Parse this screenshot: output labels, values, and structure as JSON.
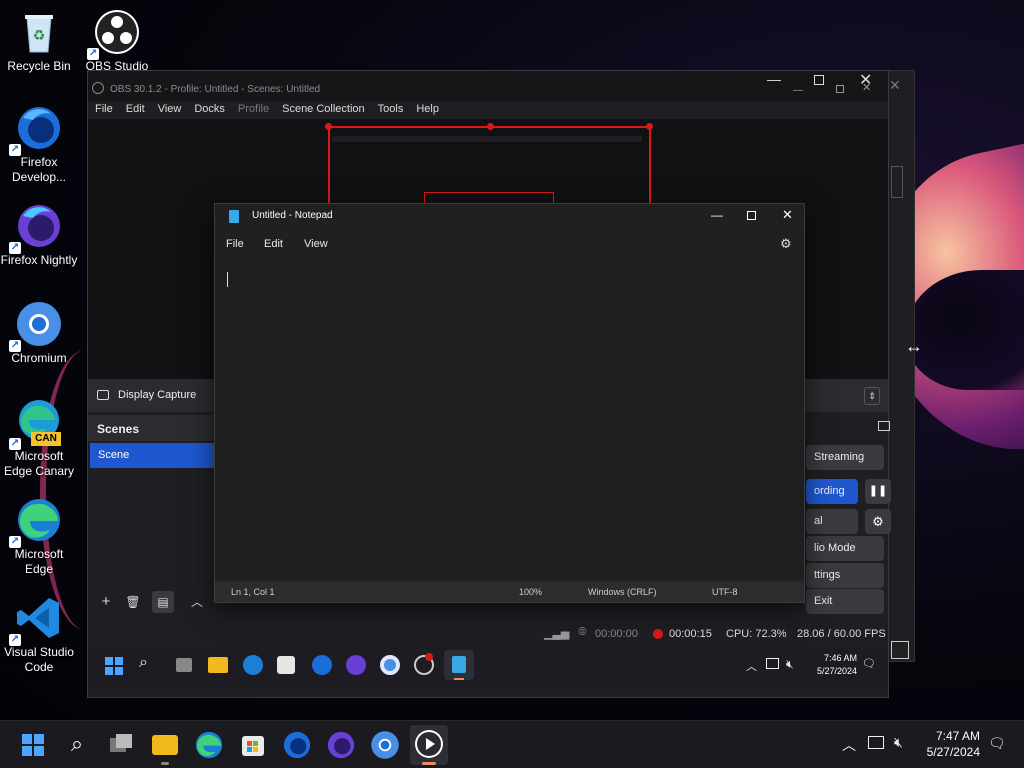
{
  "desktop": {
    "icons": [
      {
        "label": "Recycle Bin",
        "icon": "recycle-bin-icon"
      },
      {
        "label": "OBS Studio",
        "icon": "obs-icon"
      },
      {
        "label": "Firefox Develop...",
        "icon": "firefox-developer-icon"
      },
      {
        "label": "Firefox Nightly",
        "icon": "firefox-nightly-icon"
      },
      {
        "label": "Chromium",
        "icon": "chromium-icon"
      },
      {
        "label": "Microsoft Edge Canary",
        "icon": "edge-canary-icon",
        "badge": "CAN"
      },
      {
        "label": "Microsoft Edge",
        "icon": "edge-icon"
      },
      {
        "label": "Visual Studio Code",
        "icon": "vscode-icon"
      }
    ]
  },
  "obs": {
    "title": "OBS 30.1.2 - Profile: Untitled - Scenes: Untitled",
    "menu": [
      "File",
      "Edit",
      "View",
      "Docks",
      "Profile",
      "Scene Collection",
      "Tools",
      "Help"
    ],
    "source_label": "Display Capture",
    "scenes_header": "Scenes",
    "scenes": [
      "Scene"
    ],
    "controls": [
      "Streaming",
      "ording",
      "al Camera",
      "lio Mode",
      "ttings",
      "Exit"
    ],
    "status": {
      "stream_time": "00:00:00",
      "rec_time": "00:00:15",
      "cpu": "CPU: 72.3%",
      "fps": "28.06 / 60.00 FPS"
    },
    "inner_taskbar": {
      "time": "7:46 AM",
      "date": "5/27/2024"
    }
  },
  "notepad": {
    "title": "Untitled - Notepad",
    "menu": [
      "File",
      "Edit",
      "View"
    ],
    "status": {
      "position": "Ln 1, Col 1",
      "zoom": "100%",
      "line_ending": "Windows (CRLF)",
      "encoding": "UTF-8"
    }
  },
  "taskbar": {
    "time": "7:47 AM",
    "date": "5/27/2024"
  },
  "colors": {
    "accent": "#1f57ce",
    "recording": "#d71a1a",
    "notepad_bg": "#1f1f1f"
  }
}
